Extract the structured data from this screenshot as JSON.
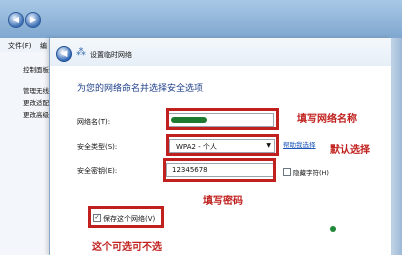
{
  "background_window": {
    "menu": [
      "文件(F)",
      "编"
    ],
    "sidebar_items": [
      "控制面板",
      "管理无线",
      "更改适配",
      "更改高级"
    ]
  },
  "dialog": {
    "title": "设置临时网络",
    "heading": "为您的网络命名并选择安全选项",
    "fields": {
      "network_name_label": "网络名(T):",
      "security_type_label": "安全类型(S):",
      "security_type_value": "WPA2 - 个人",
      "security_key_label": "安全密钥(E):",
      "security_key_value": "12345678"
    },
    "help_link": "帮助我选择",
    "hide_chars_label": "隐藏字符(H)",
    "save_network_label": "保存这个网络(V)",
    "save_network_checked": true
  },
  "annotations": {
    "fill_network_name": "填写网络名称",
    "default_choice": "默认选择",
    "fill_password": "填写密码",
    "optional_note": "这个可选可不选"
  },
  "colors": {
    "annotation_red": "#c0211e",
    "heading_blue": "#1e3f8a",
    "link_blue": "#1a56b8"
  }
}
